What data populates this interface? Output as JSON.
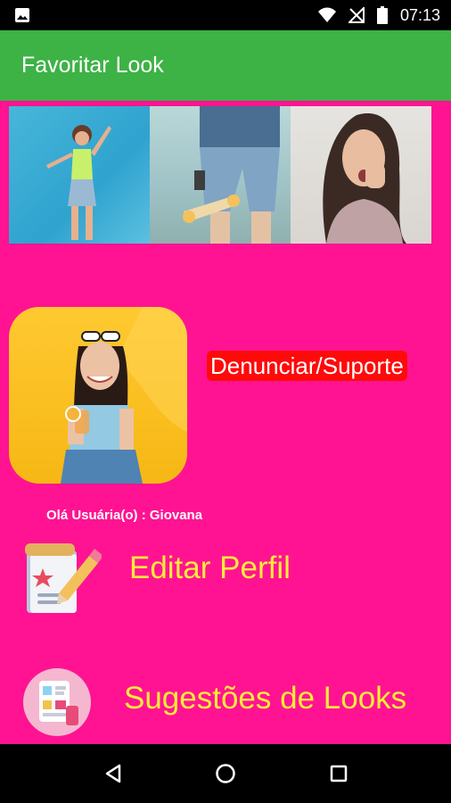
{
  "status_bar": {
    "time": "07:13",
    "icons": [
      "image-icon",
      "wifi-icon",
      "no-signal-icon",
      "battery-icon"
    ]
  },
  "app_bar": {
    "title": "Favoritar Look"
  },
  "banner": {
    "images": [
      "woman-blue-background-photo",
      "denim-shorts-skateboard-photo",
      "surprised-woman-photo"
    ]
  },
  "profile": {
    "photo": "woman-with-sunglasses-drink-photo",
    "greeting": "Olá Usuária(o) : Giovana"
  },
  "report_button": {
    "label": "Denunciar/Suporte"
  },
  "menu": {
    "items": [
      {
        "label": "Editar Perfil",
        "icon": "edit-document-icon"
      },
      {
        "label": "Sugestões de Looks",
        "icon": "suggestions-icon"
      }
    ]
  },
  "nav_bar": {
    "buttons": [
      "back-icon",
      "home-icon",
      "recents-icon"
    ]
  },
  "colors": {
    "app_bar": "#3DB245",
    "background": "#FF1392",
    "report_button": "#FF0A0A",
    "menu_text": "#FFEB3B"
  }
}
